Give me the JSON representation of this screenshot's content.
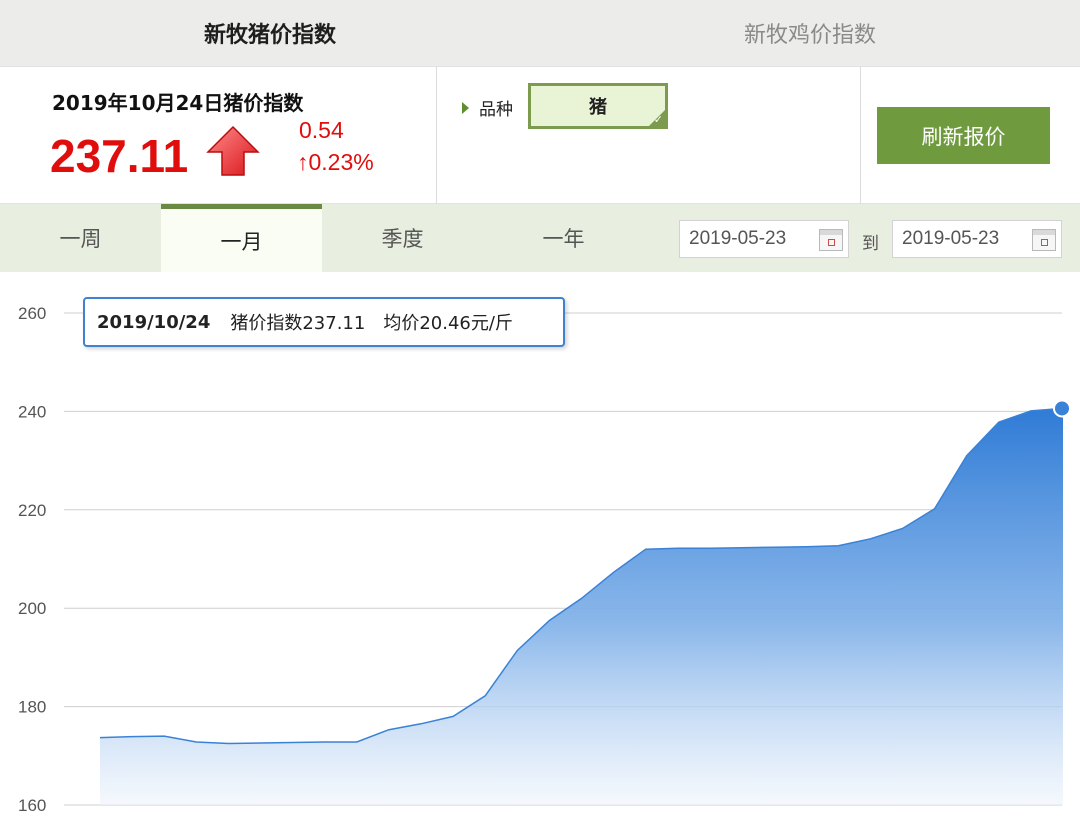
{
  "top_tabs": [
    {
      "label": "新牧猪价指数",
      "active": true
    },
    {
      "label": "新牧鸡价指数",
      "active": false
    }
  ],
  "summary": {
    "title": "2019年10月24日猪价指数",
    "value": "237.11",
    "change": "0.54",
    "change_pct": "↑0.23%",
    "trend": "up",
    "color": "#e00d0d"
  },
  "variety": {
    "label": "品种",
    "selected": "猪"
  },
  "refresh_button": "刷新报价",
  "periods": [
    {
      "label": "一周",
      "active": false
    },
    {
      "label": "一月",
      "active": true
    },
    {
      "label": "季度",
      "active": false
    },
    {
      "label": "一年",
      "active": false
    }
  ],
  "date_range": {
    "from": "2019-05-23",
    "to_label": "到",
    "to": "2019-05-23"
  },
  "tooltip": {
    "date": "2019/10/24",
    "index_text": "猪价指数237.11",
    "avg_text": "均价20.46元/斤"
  },
  "chart_data": {
    "type": "area",
    "ylim": [
      160,
      260
    ],
    "yticks": [
      160,
      180,
      200,
      220,
      240,
      260
    ],
    "grid": true,
    "color": "#3a82d6",
    "values": [
      173.7,
      173.9,
      174.0,
      172.8,
      172.5,
      172.6,
      172.7,
      172.8,
      172.8,
      175.3,
      176.5,
      178.0,
      182.2,
      191.4,
      197.5,
      202.0,
      207.3,
      212.0,
      212.2,
      212.2,
      212.3,
      212.4,
      212.5,
      212.7,
      214.1,
      216.2,
      220.2,
      231.0,
      237.8,
      240.1,
      240.6
    ]
  }
}
